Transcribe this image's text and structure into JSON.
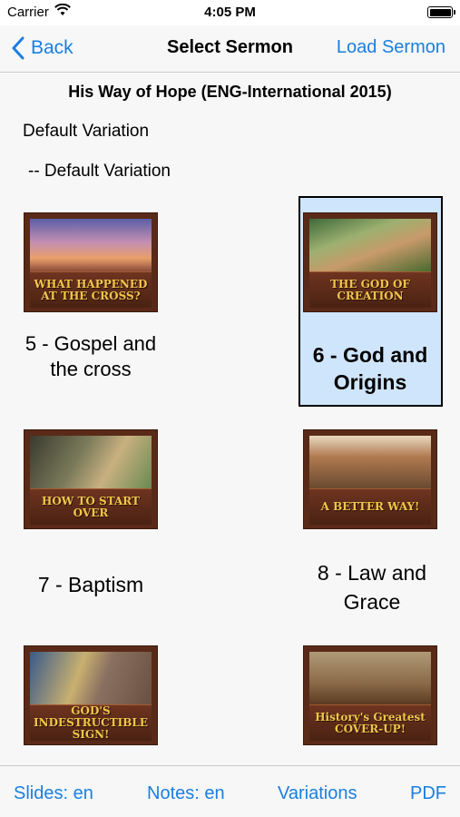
{
  "status_bar": {
    "carrier": "Carrier",
    "time": "4:05 PM"
  },
  "nav": {
    "back_label": "Back",
    "title": "Select Sermon",
    "right_label": "Load Sermon"
  },
  "sermon": {
    "title": "His Way of Hope (ENG-International 2015)",
    "variation_group": "Default Variation",
    "variation_item": "-- Default Variation"
  },
  "sermons": [
    {
      "label": "5 - Gospel and the cross",
      "thumb_text": "WHAT HAPPENED AT THE CROSS?",
      "selected": false
    },
    {
      "label": "6 - God and Origins",
      "thumb_text": "THE GOD OF CREATION",
      "selected": true
    },
    {
      "label": "7 - Baptism",
      "thumb_text": "HOW TO START OVER",
      "selected": false
    },
    {
      "label": "8 - Law and Grace",
      "thumb_text": "A BETTER WAY!",
      "selected": false
    },
    {
      "label": "",
      "thumb_text": "GOD'S INDESTRUCTIBLE SIGN!",
      "selected": false
    },
    {
      "label": "",
      "thumb_text": "History's Greatest COVER-UP!",
      "selected": false
    }
  ],
  "toolbar": {
    "slides": "Slides: en",
    "notes": "Notes: en",
    "variations": "Variations",
    "pdf": "PDF"
  },
  "colors": {
    "accent": "#1a7fe0",
    "selected_bg": "#cfe5fb",
    "thumb_frame": "#5a2a18",
    "thumb_text": "#f0c64a"
  }
}
